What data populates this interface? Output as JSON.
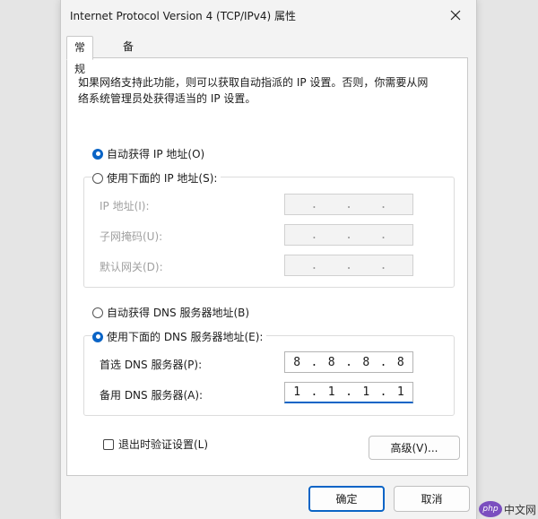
{
  "window": {
    "title": "Internet Protocol Version 4 (TCP/IPv4) 属性"
  },
  "tabs": [
    {
      "label": "常规"
    },
    {
      "label": "备用配置"
    }
  ],
  "description": {
    "line1": "如果网络支持此功能，则可以获取自动指派的 IP 设置。否则，你需要从网",
    "line2": "络系统管理员处获得适当的 IP 设置。"
  },
  "ip": {
    "auto_label": "自动获得 IP 地址(O)",
    "manual_label": "使用下面的 IP 地址(S):",
    "selected": "auto",
    "fields": [
      {
        "label": "IP 地址(I):",
        "value": [
          "",
          "",
          "",
          ""
        ]
      },
      {
        "label": "子网掩码(U):",
        "value": [
          "",
          "",
          "",
          ""
        ]
      },
      {
        "label": "默认网关(D):",
        "value": [
          "",
          "",
          "",
          ""
        ]
      }
    ]
  },
  "dns": {
    "auto_label": "自动获得 DNS 服务器地址(B)",
    "manual_label": "使用下面的 DNS 服务器地址(E):",
    "selected": "manual",
    "fields": [
      {
        "label": "首选 DNS 服务器(P):",
        "value": [
          "8",
          "8",
          "8",
          "8"
        ]
      },
      {
        "label": "备用 DNS 服务器(A):",
        "value": [
          "1",
          "1",
          "1",
          "1"
        ]
      }
    ]
  },
  "validate": {
    "label": "退出时验证设置(L)",
    "checked": false
  },
  "buttons": {
    "advanced": "高级(V)...",
    "ok": "确定",
    "cancel": "取消"
  },
  "watermark": {
    "logo": "php",
    "text": "中文网"
  },
  "colors": {
    "accent": "#0a64c6"
  }
}
